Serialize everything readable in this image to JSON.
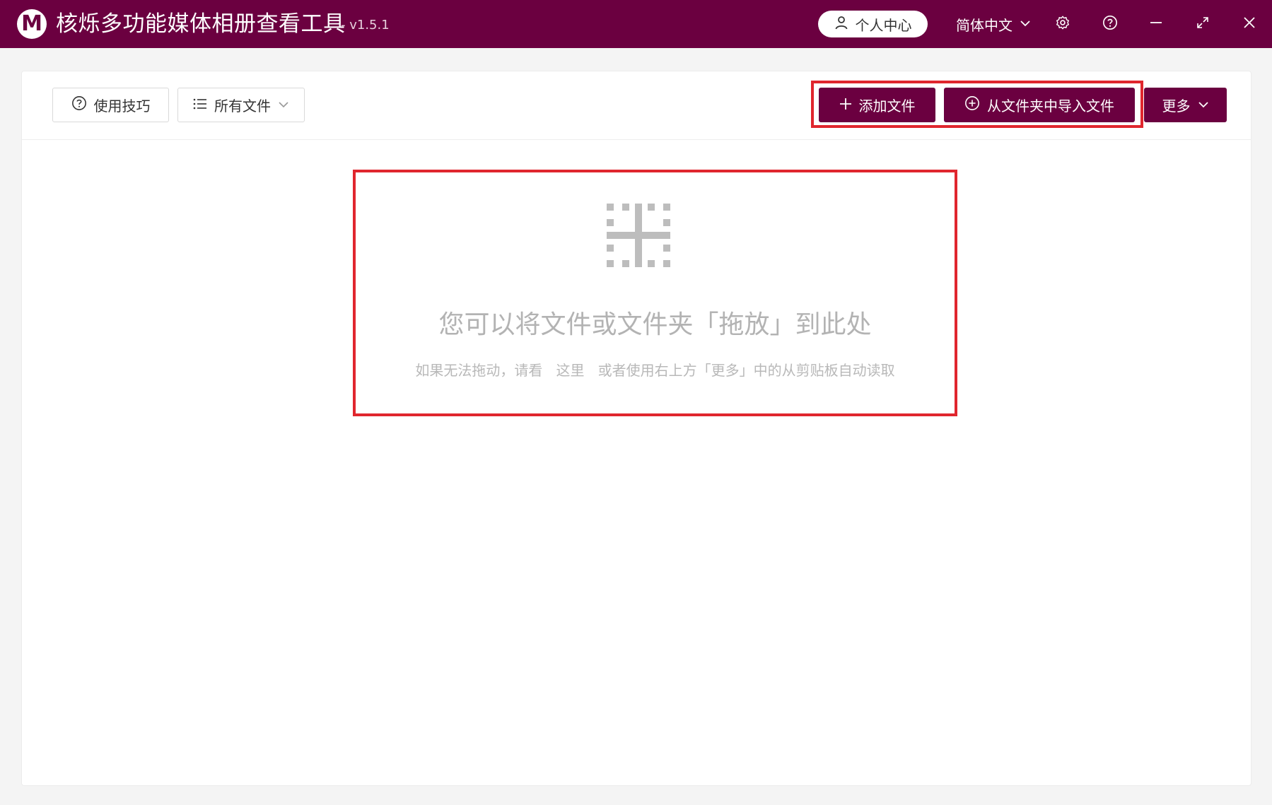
{
  "window": {
    "logo_letter": "M",
    "title": "核烁多功能媒体相册查看工具",
    "version": "- v1.5.1",
    "user_center": "个人中心",
    "language": "简体中文",
    "colors": {
      "accent": "#6b0040",
      "highlight": "#e0262e"
    }
  },
  "toolbar": {
    "tips_label": "使用技巧",
    "filter_label": "所有文件",
    "add_file_label": "添加文件",
    "import_folder_label": "从文件夹中导入文件",
    "more_label": "更多"
  },
  "dropzone": {
    "title": "您可以将文件或文件夹「拖放」到此处",
    "hint_prefix": "如果无法拖动，请看",
    "hint_link": "这里",
    "hint_suffix": "或者使用右上方「更多」中的从剪贴板自动读取"
  },
  "icons": [
    "user-icon",
    "chevron-down-icon",
    "gear-icon",
    "help-icon",
    "minimize-icon",
    "maximize-icon",
    "close-icon",
    "question-circle-icon",
    "list-icon",
    "plus-icon",
    "plus-circle-icon",
    "drop-target-icon"
  ]
}
